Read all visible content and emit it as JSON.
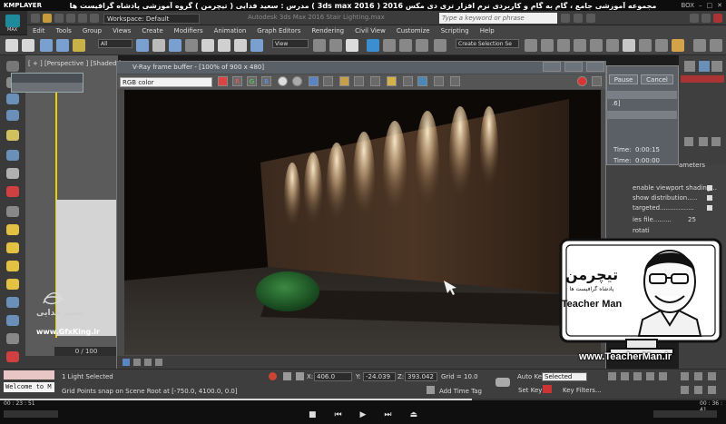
{
  "player": {
    "app": "KMPLAYER",
    "video_title": "مجموعه آموزشی جامع ، گام به گام و کاربردی نرم افزار تری دی مکس 2016 ( 3ds max 2016 ) مدرس : سعید فدایی ( تیچرمن ) گروه آموزشی پادشاه گرافیست ها",
    "right_label": "BOX",
    "time_current": "00 : 23 : 51",
    "time_total": "00 : 36 : 41",
    "progress": 0.65
  },
  "max": {
    "logo_label": "MAX",
    "workspace": "Workspace: Default",
    "app_title": "Autodesk 3ds Max 2016   Stair Lighting.max",
    "search_placeholder": "Type a keyword or phrase",
    "menu": [
      "Edit",
      "Tools",
      "Group",
      "Views",
      "Create",
      "Modifiers",
      "Animation",
      "Graph Editors",
      "Rendering",
      "Civil View",
      "Customize",
      "Scripting",
      "Help"
    ],
    "selection_filter": "All",
    "ref_coord": "View",
    "selection_set": "Create Selection Se"
  },
  "viewport": {
    "label": "[ + ] [Perspective ] [Shaded ]",
    "frame_range": "0 / 100"
  },
  "watermark": {
    "name": "سعید فدایی",
    "site": "www.GfxKing.ir"
  },
  "vfb": {
    "title": "V-Ray frame buffer - [100% of 900 x 480]",
    "channel": "RGB color",
    "btn_r": "R",
    "btn_g": "G",
    "btn_b": "B"
  },
  "render_dialog": {
    "pause": "Pause",
    "cancel": "Cancel",
    "value_label": ".6]",
    "time1_label": "Time:",
    "time1": "0:00:15",
    "time2_label": "Time:",
    "time2": "0:00:00"
  },
  "params": {
    "title": "ameters",
    "rows": [
      "enable viewport shading...",
      "show distribution.....",
      "targeted................."
    ],
    "ies_label": "ies file.........",
    "ies_value": "25",
    "rotate_label": "rotati"
  },
  "status": {
    "selected": "1 Light Selected",
    "prompt": "Grid Points snap on Scene Root at [-750.0, 4100.0, 0.0]",
    "x_label": "X:",
    "x": "406.0",
    "y_label": "Y:",
    "y": "-24.039",
    "z_label": "Z:",
    "z": "393.042",
    "grid": "Grid = 10.0",
    "add_time_tag": "Add Time Tag",
    "auto_key": "Auto Key",
    "set_key": "Set Key",
    "selected_dd": "Selected",
    "key_filters": "Key Filters...",
    "welcome": "Welcome to M"
  },
  "brand": {
    "logo_fa": "تیچرمن",
    "logo_sub": "پادشاه گرافیست ها",
    "logo_en": "Teacher Man",
    "site": "www.TeacherMan.ir"
  },
  "colors": {
    "max_accent": "#1f8a9c",
    "viewport_gray": "#5b5b5b",
    "selection_yellow": "#e6d200",
    "light_warm": "#f5d7a6"
  }
}
